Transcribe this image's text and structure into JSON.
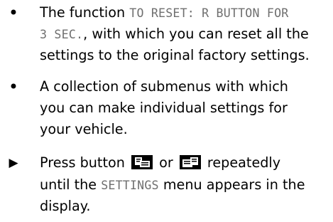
{
  "bullets": [
    {
      "marker": "•",
      "lines": [
        {
          "pre": "The function ",
          "code": "TO RESET: R BUTTON FOR"
        },
        {
          "code": "3 SEC.",
          "post": ", with which you can reset all the"
        },
        {
          "text": "settings to the original factory settings."
        }
      ]
    },
    {
      "marker": "•",
      "lines": [
        {
          "text": "A collection of submenus with which"
        },
        {
          "text": "you can make individual settings for"
        },
        {
          "text": "your vehicle."
        }
      ]
    }
  ],
  "instruction": {
    "marker": "▶",
    "line1_pre": "Press button ",
    "button_left_icon": "page-back-button-icon",
    "line1_mid": " or ",
    "button_right_icon": "page-forward-button-icon",
    "line1_post": " repeatedly",
    "line2_pre": "until the ",
    "line2_code": "SETTINGS",
    "line2_post": " menu appears in the",
    "line3": "display."
  },
  "colors": {
    "text": "#000000",
    "code_text": "#6f6f6f",
    "icon_fill": "#000000"
  }
}
